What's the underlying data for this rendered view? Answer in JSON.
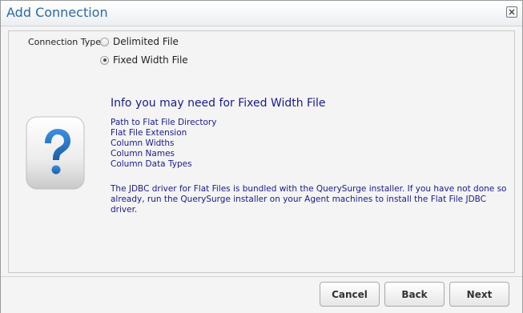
{
  "dialog": {
    "title": "Add Connection",
    "close_icon": "close-icon"
  },
  "connection_type": {
    "label": "Connection Type:",
    "options": [
      {
        "label": "Delimited File",
        "selected": false
      },
      {
        "label": "Fixed Width File",
        "selected": true
      }
    ]
  },
  "info": {
    "icon": "question-mark-icon",
    "title": "Info you may need for Fixed Width File",
    "items": [
      "Path to Flat File Directory",
      "Flat File Extension",
      "Column Widths",
      "Column Names",
      "Column Data Types"
    ],
    "note": "The JDBC driver for Flat Files is bundled with the QuerySurge installer. If you have not done so already, run the QuerySurge installer on your Agent machines to install the Flat File JDBC driver."
  },
  "buttons": {
    "cancel": "Cancel",
    "back": "Back",
    "next": "Next"
  },
  "colors": {
    "title": "#2e6aa0",
    "info_text": "#1a1a8c",
    "icon_blue": "#1f6fbf"
  }
}
